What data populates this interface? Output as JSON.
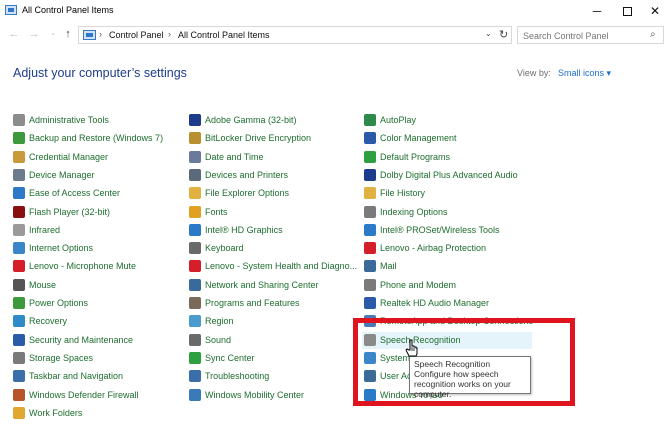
{
  "window": {
    "title": "All Control Panel Items",
    "min_glyph": "─",
    "close_glyph": "✕"
  },
  "nav": {
    "back_glyph": "←",
    "forward_glyph": "→",
    "recent_glyph": "⌄",
    "up_glyph": "↑",
    "breadcrumb": [
      "Control Panel",
      "All Control Panel Items"
    ],
    "separator": "›",
    "dropdown_glyph": "⌄",
    "refresh_glyph": "↻",
    "search_placeholder": "Search Control Panel",
    "search_glyph": "⌕"
  },
  "header": {
    "title": "Adjust your computer’s settings",
    "view_by_label": "View by:",
    "view_by_value": "Small icons ▾"
  },
  "columns": [
    [
      {
        "label": "Administrative Tools",
        "icon": "admin-tools-icon",
        "color": "#8c8c8c"
      },
      {
        "label": "Backup and Restore (Windows 7)",
        "icon": "backup-icon",
        "color": "#3c9a3c"
      },
      {
        "label": "Credential Manager",
        "icon": "credential-icon",
        "color": "#c89a3a"
      },
      {
        "label": "Device Manager",
        "icon": "device-manager-icon",
        "color": "#6b7b8c"
      },
      {
        "label": "Ease of Access Center",
        "icon": "ease-of-access-icon",
        "color": "#2e78c8"
      },
      {
        "label": "Flash Player (32-bit)",
        "icon": "flash-icon",
        "color": "#8a1010"
      },
      {
        "label": "Infrared",
        "icon": "infrared-icon",
        "color": "#9a9a9a"
      },
      {
        "label": "Internet Options",
        "icon": "internet-options-icon",
        "color": "#3a86c8"
      },
      {
        "label": "Lenovo - Microphone Mute",
        "icon": "microphone-mute-icon",
        "color": "#d41e2a"
      },
      {
        "label": "Mouse",
        "icon": "mouse-icon",
        "color": "#555555"
      },
      {
        "label": "Power Options",
        "icon": "power-icon",
        "color": "#3c9a3c"
      },
      {
        "label": "Recovery",
        "icon": "recovery-icon",
        "color": "#2e8ac8"
      },
      {
        "label": "Security and Maintenance",
        "icon": "flag-icon",
        "color": "#2a5aa8"
      },
      {
        "label": "Storage Spaces",
        "icon": "storage-icon",
        "color": "#7a7a7a"
      },
      {
        "label": "Taskbar and Navigation",
        "icon": "taskbar-icon",
        "color": "#3a6ea8"
      },
      {
        "label": "Windows Defender Firewall",
        "icon": "firewall-icon",
        "color": "#b8542a"
      },
      {
        "label": "Work Folders",
        "icon": "work-folders-icon",
        "color": "#e0a830"
      }
    ],
    [
      {
        "label": "Adobe Gamma (32-bit)",
        "icon": "adobe-gamma-icon",
        "color": "#1e3c8c"
      },
      {
        "label": "BitLocker Drive Encryption",
        "icon": "bitlocker-icon",
        "color": "#b89030"
      },
      {
        "label": "Date and Time",
        "icon": "date-time-icon",
        "color": "#6a7a9a"
      },
      {
        "label": "Devices and Printers",
        "icon": "printer-icon",
        "color": "#5a6a7a"
      },
      {
        "label": "File Explorer Options",
        "icon": "folder-options-icon",
        "color": "#e0b040"
      },
      {
        "label": "Fonts",
        "icon": "fonts-icon",
        "color": "#e0a020"
      },
      {
        "label": "Intel® HD Graphics",
        "icon": "intel-graphics-icon",
        "color": "#2a7ac8"
      },
      {
        "label": "Keyboard",
        "icon": "keyboard-icon",
        "color": "#6a6a6a"
      },
      {
        "label": "Lenovo - System Health and Diagno...",
        "icon": "system-health-icon",
        "color": "#d41e2a"
      },
      {
        "label": "Network and Sharing Center",
        "icon": "network-icon",
        "color": "#3a6a9a"
      },
      {
        "label": "Programs and Features",
        "icon": "programs-icon",
        "color": "#7a6a5a"
      },
      {
        "label": "Region",
        "icon": "region-icon",
        "color": "#4a9ad0"
      },
      {
        "label": "Sound",
        "icon": "sound-icon",
        "color": "#6a6a6a"
      },
      {
        "label": "Sync Center",
        "icon": "sync-icon",
        "color": "#2ea040"
      },
      {
        "label": "Troubleshooting",
        "icon": "troubleshooting-icon",
        "color": "#3a6ea8"
      },
      {
        "label": "Windows Mobility Center",
        "icon": "mobility-icon",
        "color": "#3a7ab8"
      }
    ],
    [
      {
        "label": "AutoPlay",
        "icon": "autoplay-icon",
        "color": "#2e8a4a"
      },
      {
        "label": "Color Management",
        "icon": "color-management-icon",
        "color": "#2a5aa8"
      },
      {
        "label": "Default Programs",
        "icon": "default-programs-icon",
        "color": "#2ea040"
      },
      {
        "label": "Dolby Digital Plus Advanced Audio",
        "icon": "dolby-icon",
        "color": "#1e3c8c"
      },
      {
        "label": "File History",
        "icon": "file-history-icon",
        "color": "#e0b040"
      },
      {
        "label": "Indexing Options",
        "icon": "indexing-icon",
        "color": "#7a7a7a"
      },
      {
        "label": "Intel® PROSet/Wireless Tools",
        "icon": "intel-wireless-icon",
        "color": "#2a7ac8"
      },
      {
        "label": "Lenovo - Airbag Protection",
        "icon": "airbag-icon",
        "color": "#d41e2a"
      },
      {
        "label": "Mail",
        "icon": "mail-icon",
        "color": "#3a6a9a"
      },
      {
        "label": "Phone and Modem",
        "icon": "phone-modem-icon",
        "color": "#7a7a7a"
      },
      {
        "label": "Realtek HD Audio Manager",
        "icon": "realtek-icon",
        "color": "#2a5aa8"
      },
      {
        "label": "RemoteApp and Desktop Connections",
        "icon": "remoteapp-icon",
        "color": "#4a7ab8"
      },
      {
        "label": "Speech Recognition",
        "icon": "microphone-icon",
        "color": "#8a8a8a"
      },
      {
        "label": "System",
        "icon": "system-icon",
        "color": "#3a86c8"
      },
      {
        "label": "User Ac",
        "icon": "user-accounts-icon",
        "color": "#3a6a9a"
      },
      {
        "label": "Windows To Go",
        "icon": "windows-to-go-icon",
        "color": "#2a7ac8"
      }
    ]
  ],
  "tooltip": {
    "title": "Speech Recognition",
    "description": "Configure how speech recognition works on your computer."
  },
  "colors": {
    "link_green": "#1e6e2e",
    "heading_blue": "#1e3c8c",
    "highlight_red": "#e0141e",
    "hover_blue": "#e5f3fb"
  }
}
